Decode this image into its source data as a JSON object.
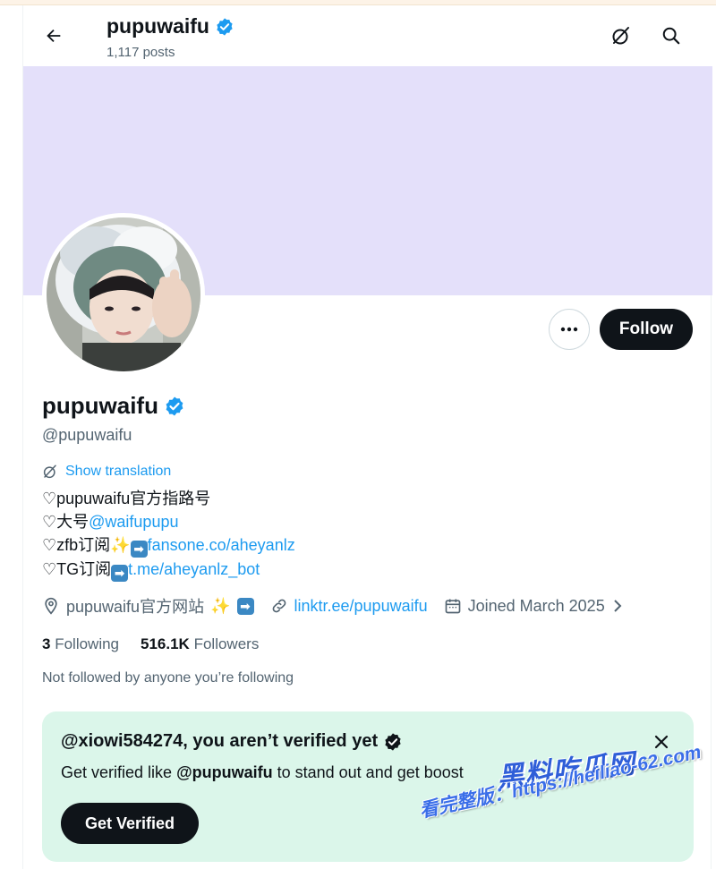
{
  "header": {
    "name": "pupuwaifu",
    "post_count": "1,117 posts"
  },
  "colors": {
    "banner": "#e4e0fa",
    "accent": "#1d9bf0",
    "verify_card": "#dbf6ea"
  },
  "icons": {
    "back": "arrow-left-icon",
    "grok": "grok-icon",
    "search": "search-icon",
    "verified": "verified-badge-icon"
  },
  "profile": {
    "display_name": "pupuwaifu",
    "handle": "@pupuwaifu",
    "show_translation": "Show translation",
    "bio": {
      "line1": "♡pupuwaifu官方指路号",
      "line2_prefix": "♡大号",
      "line2_link": "@waifupupu",
      "line3_prefix": "♡zfb订阅",
      "line3_link": "fansone.co/aheyanlz",
      "line4_prefix": "♡TG订阅",
      "line4_link": "t.me/aheyanlz_bot"
    },
    "location": "pupuwaifu官方网站",
    "website": "linktr.ee/pupuwaifu",
    "joined": "Joined March 2025",
    "following_count": "3",
    "following_label": "Following",
    "followers_count": "516.1K",
    "followers_label": "Followers",
    "not_followed": "Not followed by anyone you’re following"
  },
  "actions": {
    "follow_label": "Follow"
  },
  "verify_card": {
    "title": "@xiowi584274, you aren’t verified yet",
    "desc_prefix": "Get verified like ",
    "desc_handle": "@pupuwaifu",
    "desc_suffix": " to stand out and get boost",
    "button_label": "Get Verified"
  },
  "watermark": {
    "logo": "黑料吃瓜网",
    "url": "看完整版：https://heiliao-62.com"
  }
}
